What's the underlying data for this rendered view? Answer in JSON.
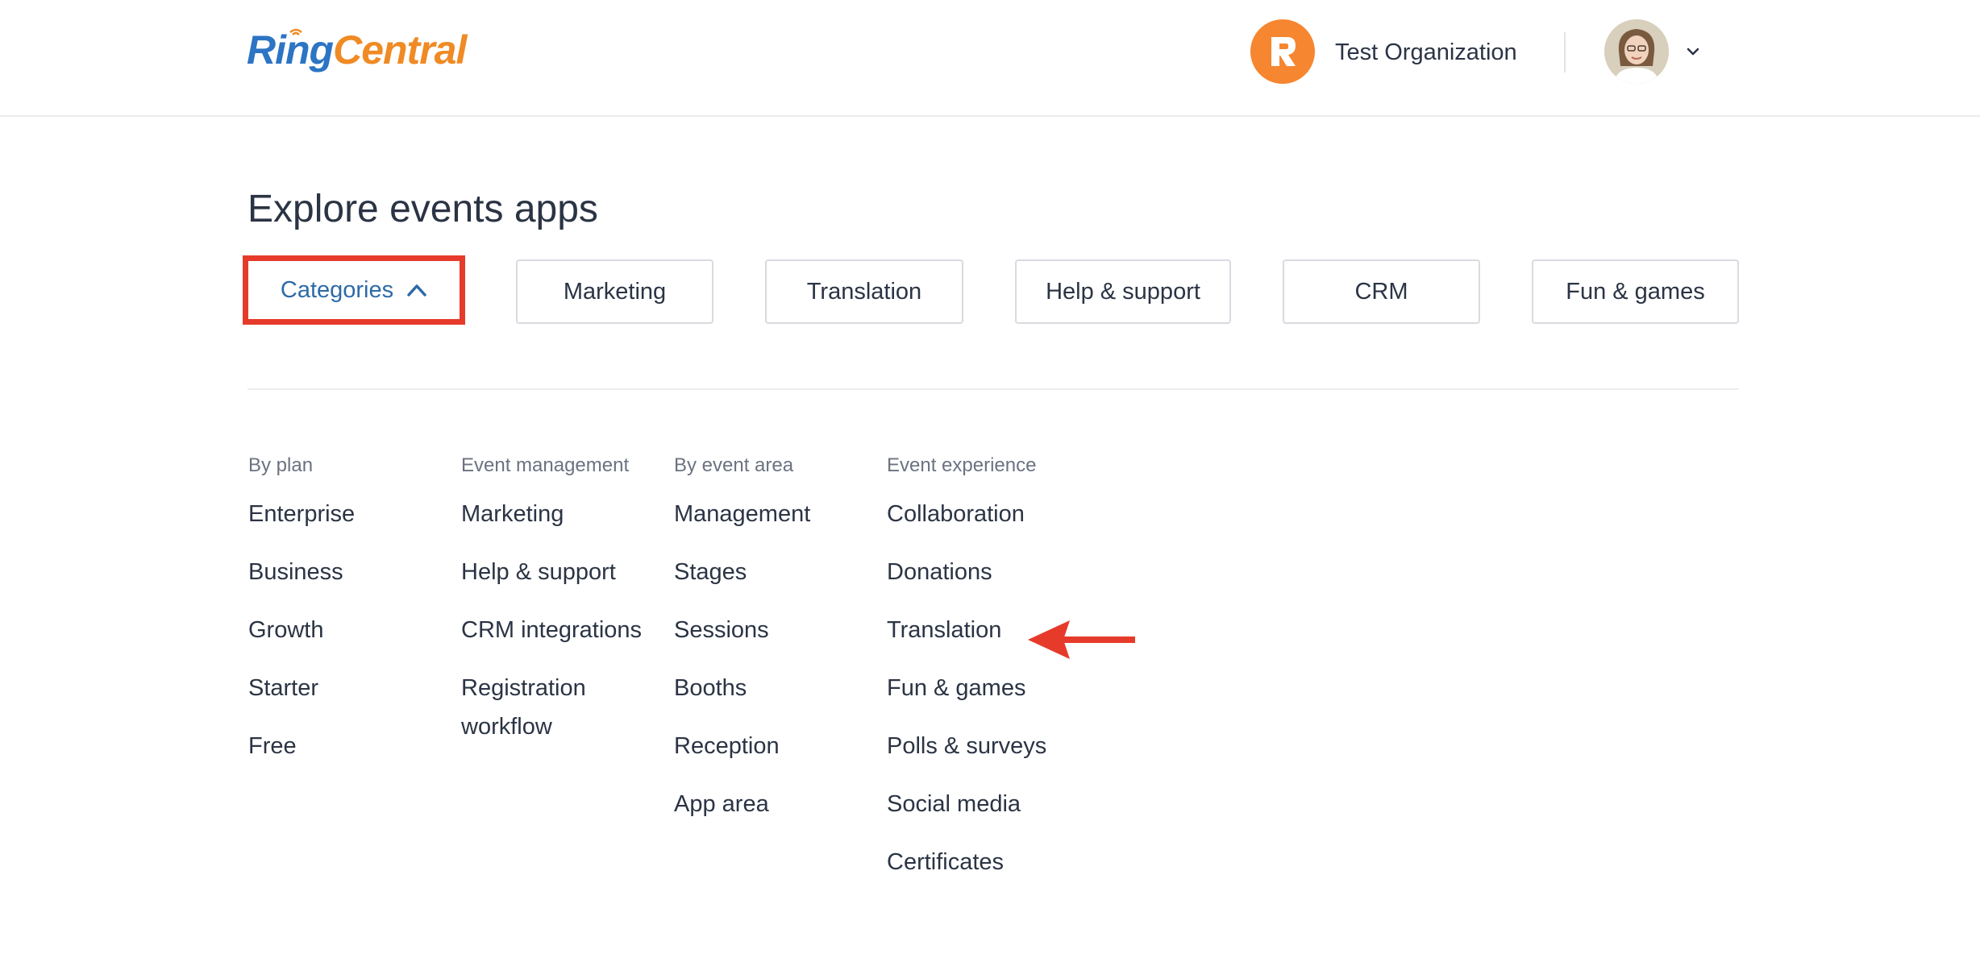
{
  "header": {
    "logo_ring": "Ring",
    "logo_central": "Central",
    "org_name": "Test Organization"
  },
  "page_title": "Explore events apps",
  "tabs": {
    "categories": "Categories",
    "marketing": "Marketing",
    "translation": "Translation",
    "help_support": "Help & support",
    "crm": "CRM",
    "fun_games": "Fun & games"
  },
  "columns": {
    "by_plan": {
      "heading": "By plan",
      "items": [
        "Enterprise",
        "Business",
        "Growth",
        "Starter",
        "Free"
      ]
    },
    "event_management": {
      "heading": "Event management",
      "items": [
        "Marketing",
        "Help & support",
        "CRM integrations",
        "Registration workflow"
      ]
    },
    "by_event_area": {
      "heading": "By event area",
      "items": [
        "Management",
        "Stages",
        "Sessions",
        "Booths",
        "Reception",
        "App area"
      ]
    },
    "event_experience": {
      "heading": "Event experience",
      "items": [
        "Collaboration",
        "Donations",
        "Translation",
        "Fun & games",
        "Polls & surveys",
        "Social media",
        "Certificates"
      ]
    }
  },
  "colors": {
    "brand_blue": "#2c74c4",
    "brand_orange": "#f08a24",
    "highlight_red": "#e63b2a",
    "text": "#2b3444",
    "muted": "#6b7280"
  },
  "icons": [
    "ringcentral-logo",
    "org-avatar-icon",
    "user-avatar",
    "chevron-down-icon",
    "chevron-up-icon",
    "red-arrow-annotation"
  ]
}
